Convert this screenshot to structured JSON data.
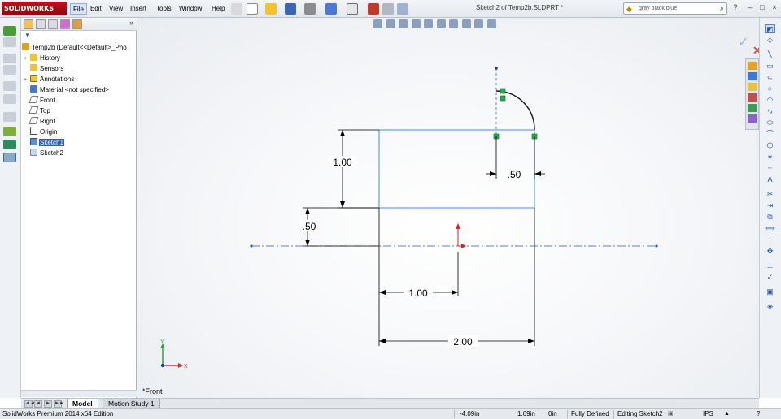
{
  "app": {
    "logo_text": "SOLIDWORKS",
    "document_title": "Sketch2 of Temp2b.SLDPRT *"
  },
  "menu": [
    "File",
    "Edit",
    "View",
    "Insert",
    "Tools",
    "Window",
    "Help"
  ],
  "search": {
    "value": "gray black blue"
  },
  "window_controls": [
    "?",
    "–",
    "□",
    "×"
  ],
  "feature_manager": {
    "collapse_glyph": "»",
    "filter_glyph": "▼",
    "root": "Temp2b  (Default<<Default>_Pho",
    "items": [
      {
        "label": "History",
        "expand": "+"
      },
      {
        "label": "Sensors",
        "expand": ""
      },
      {
        "label": "Annotations",
        "expand": "+"
      },
      {
        "label": "Material <not specified>",
        "expand": ""
      },
      {
        "label": "Front",
        "expand": ""
      },
      {
        "label": "Top",
        "expand": ""
      },
      {
        "label": "Right",
        "expand": ""
      },
      {
        "label": "Origin",
        "expand": ""
      },
      {
        "label": "Sketch1",
        "expand": "",
        "selected": true
      },
      {
        "label": "Sketch2",
        "expand": ""
      }
    ]
  },
  "graphics": {
    "view_label": "*Front",
    "dimensions": {
      "height": "1.00",
      "offset_vertical": ".50",
      "arc_offset": ".50",
      "origin_offset": "1.00",
      "width": "2.00"
    },
    "triad": {
      "x": "X",
      "y": "Y"
    },
    "confirm": {
      "ok": "✓",
      "cancel": "✕"
    },
    "colors": {
      "sketch_blue": "#3f8fe0",
      "dimension_black": "#000000",
      "centerline": "#4a86d8",
      "endpoint_green": "#22b04a",
      "origin_red": "#e02020"
    }
  },
  "bottom_tabs": {
    "nav": [
      "◄◄",
      "◄",
      "►",
      "►►"
    ],
    "model": "Model",
    "motion": "Motion Study 1"
  },
  "status": {
    "edition": "SolidWorks Premium 2014 x64 Edition",
    "x": "-4.09in",
    "y": "1.69in",
    "z": "0in",
    "state": "Fully Defined",
    "mode": "Editing Sketch2",
    "units": "IPS",
    "units_arrow": "▲",
    "help": "?"
  }
}
